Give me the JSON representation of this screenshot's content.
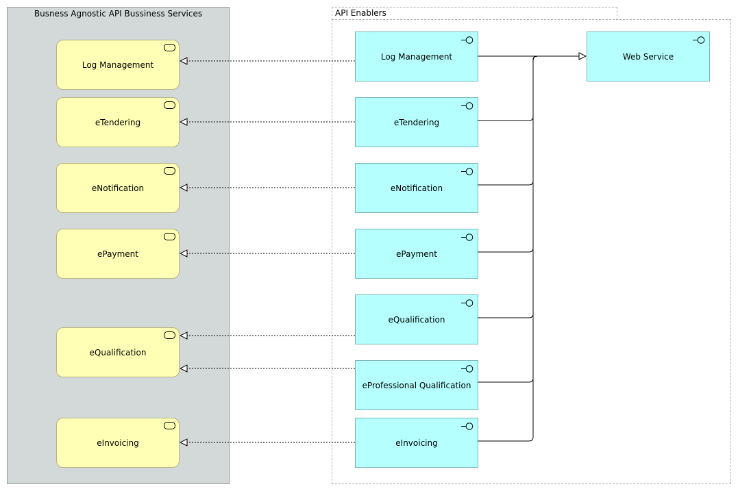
{
  "left_group": {
    "title": "Busness Agnostic API Bussiness Services",
    "services": [
      {
        "label": "Log Management"
      },
      {
        "label": "eTendering"
      },
      {
        "label": "eNotification"
      },
      {
        "label": "ePayment"
      },
      {
        "label": "eQualification"
      },
      {
        "label": "eInvoicing"
      }
    ]
  },
  "right_group": {
    "title": "API Enablers",
    "interfaces": [
      {
        "label": "Log Management"
      },
      {
        "label": "eTendering"
      },
      {
        "label": "eNotification"
      },
      {
        "label": "ePayment"
      },
      {
        "label": "eQualification"
      },
      {
        "label": "eProfessional Qualification"
      },
      {
        "label": "eInvoicing"
      }
    ],
    "target": {
      "label": "Web Service"
    }
  },
  "colors": {
    "business_service": "#ffffb5",
    "application_interface": "#b5ffff",
    "group_fill": "#d3d8d9"
  }
}
